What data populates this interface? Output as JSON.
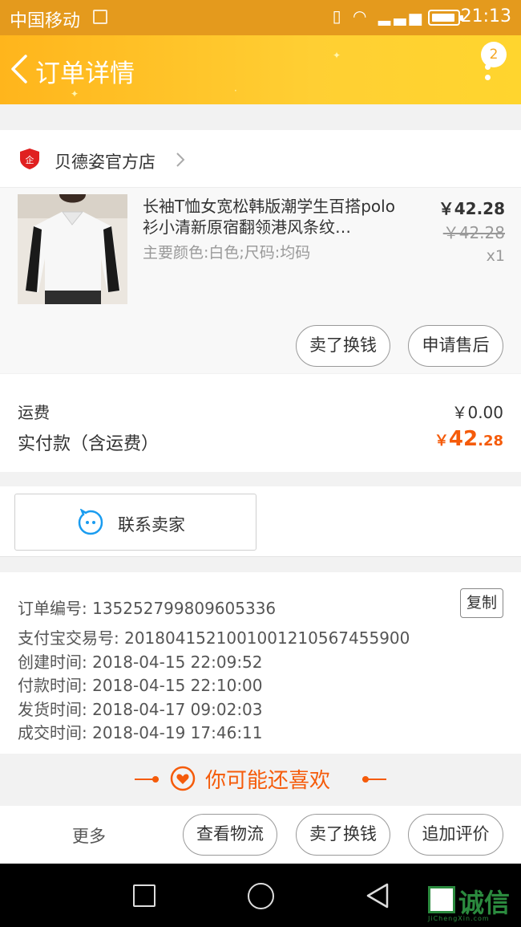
{
  "status_bar": {
    "carrier": "中国移动",
    "network_icons": "▯ ◠ ▂▃▅",
    "time": "21:13"
  },
  "header": {
    "title": "订单详情",
    "badge_count": "2",
    "back_icon": "chevron-left-icon",
    "menu_icon": "more-vertical-icon",
    "gradient_from": "#ffb51c",
    "gradient_to": "#ffd52e"
  },
  "shop": {
    "name": "贝德姿官方店",
    "icon": "enterprise-shield-icon"
  },
  "product": {
    "name": "长袖T恤女宽松韩版潮学生百搭polo衫小清新原宿翻领港风条纹…",
    "sku": "主要颜色:白色;尺码:均码",
    "price": "￥42.28",
    "original_price": "￥42.28",
    "quantity": "x1",
    "actions": {
      "exchange": "卖了换钱",
      "after_sale": "申请售后"
    }
  },
  "fees": {
    "shipping_label": "运费",
    "shipping_value": "￥0.00",
    "paid_label": "实付款（含运费）",
    "paid_currency": "￥",
    "paid_integer": "42",
    "paid_decimal": ".28",
    "accent_color": "#f55b0a"
  },
  "contact": {
    "label": "联系卖家",
    "icon": "chat-bubble-icon"
  },
  "order_info": {
    "order_no": "订单编号: 135252799809605336",
    "alipay_no": "支付宝交易号: 2018041521001001210567455900",
    "created": "创建时间: 2018-04-15 22:09:52",
    "paid": "付款时间: 2018-04-15 22:10:00",
    "shipped": "发货时间: 2018-04-17 09:02:03",
    "completed": "成交时间: 2018-04-19 17:46:11",
    "copy_label": "复制"
  },
  "recommend": {
    "text": "你可能还喜欢",
    "icon": "heart-icon"
  },
  "action_bar": {
    "more": "更多",
    "logistics": "查看物流",
    "exchange": "卖了换钱",
    "add_review": "追加评价"
  },
  "watermark": {
    "text": "诚信",
    "sub": "JiChengXin.com"
  }
}
